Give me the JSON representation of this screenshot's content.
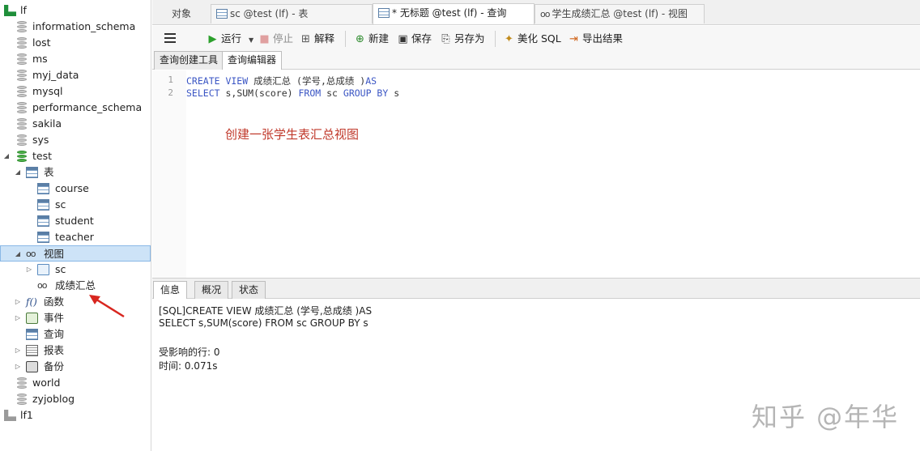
{
  "sidebar": {
    "connection": "lf",
    "databases": [
      "information_schema",
      "lost",
      "ms",
      "myj_data",
      "mysql",
      "performance_schema",
      "sakila",
      "sys"
    ],
    "open_db": "test",
    "tables_node": "表",
    "tables": [
      "course",
      "sc",
      "student",
      "teacher"
    ],
    "views_node": "视图",
    "views": [
      "sc",
      "成绩汇总"
    ],
    "functions_node": "函数",
    "events_node": "事件",
    "queries_node": "查询",
    "reports_node": "报表",
    "backups_node": "备份",
    "more_databases": [
      "world",
      "zyjoblog"
    ],
    "other_connection": "lf1"
  },
  "tabs": {
    "objects": "对象",
    "table_tab": "sc @test (lf) - 表",
    "query_tab": "* 无标题 @test (lf) - 查询",
    "view_tab": "学生成绩汇总 @test (lf) - 视图"
  },
  "toolbar": {
    "run": "运行",
    "stop": "停止",
    "explain": "解释",
    "new": "新建",
    "save": "保存",
    "save_as": "另存为",
    "beautify": "美化 SQL",
    "export": "导出结果"
  },
  "editor_tabs": {
    "builder": "查询创建工具",
    "editor": "查询编辑器"
  },
  "editor": {
    "line_numbers": [
      "1",
      "2"
    ],
    "line1": {
      "kw1": "CREATE VIEW",
      "text": " 成绩汇总 (学号,总成绩 )",
      "kw2": "AS"
    },
    "line2": {
      "kw1": "SELECT",
      "text1": " s,SUM(score) ",
      "kw2": "FROM",
      "text2": " sc ",
      "kw3": "GROUP BY",
      "text3": " s"
    },
    "annotation": "创建一张学生表汇总视图"
  },
  "result_tabs": {
    "info": "信息",
    "overview": "概况",
    "status": "状态"
  },
  "result": {
    "sql_line1": "[SQL]CREATE VIEW 成绩汇总 (学号,总成绩 )AS",
    "sql_line2": "SELECT s,SUM(score) FROM sc GROUP BY s",
    "affected_rows": "受影响的行: 0",
    "time": "时间: 0.071s"
  },
  "watermark": "知乎 @年华",
  "colors": {
    "keyword": "#3b56c4",
    "annotation": "#c0392b",
    "selection": "#cde3f7",
    "db_open": "#4db14a",
    "run_icon": "#2ca02c"
  }
}
